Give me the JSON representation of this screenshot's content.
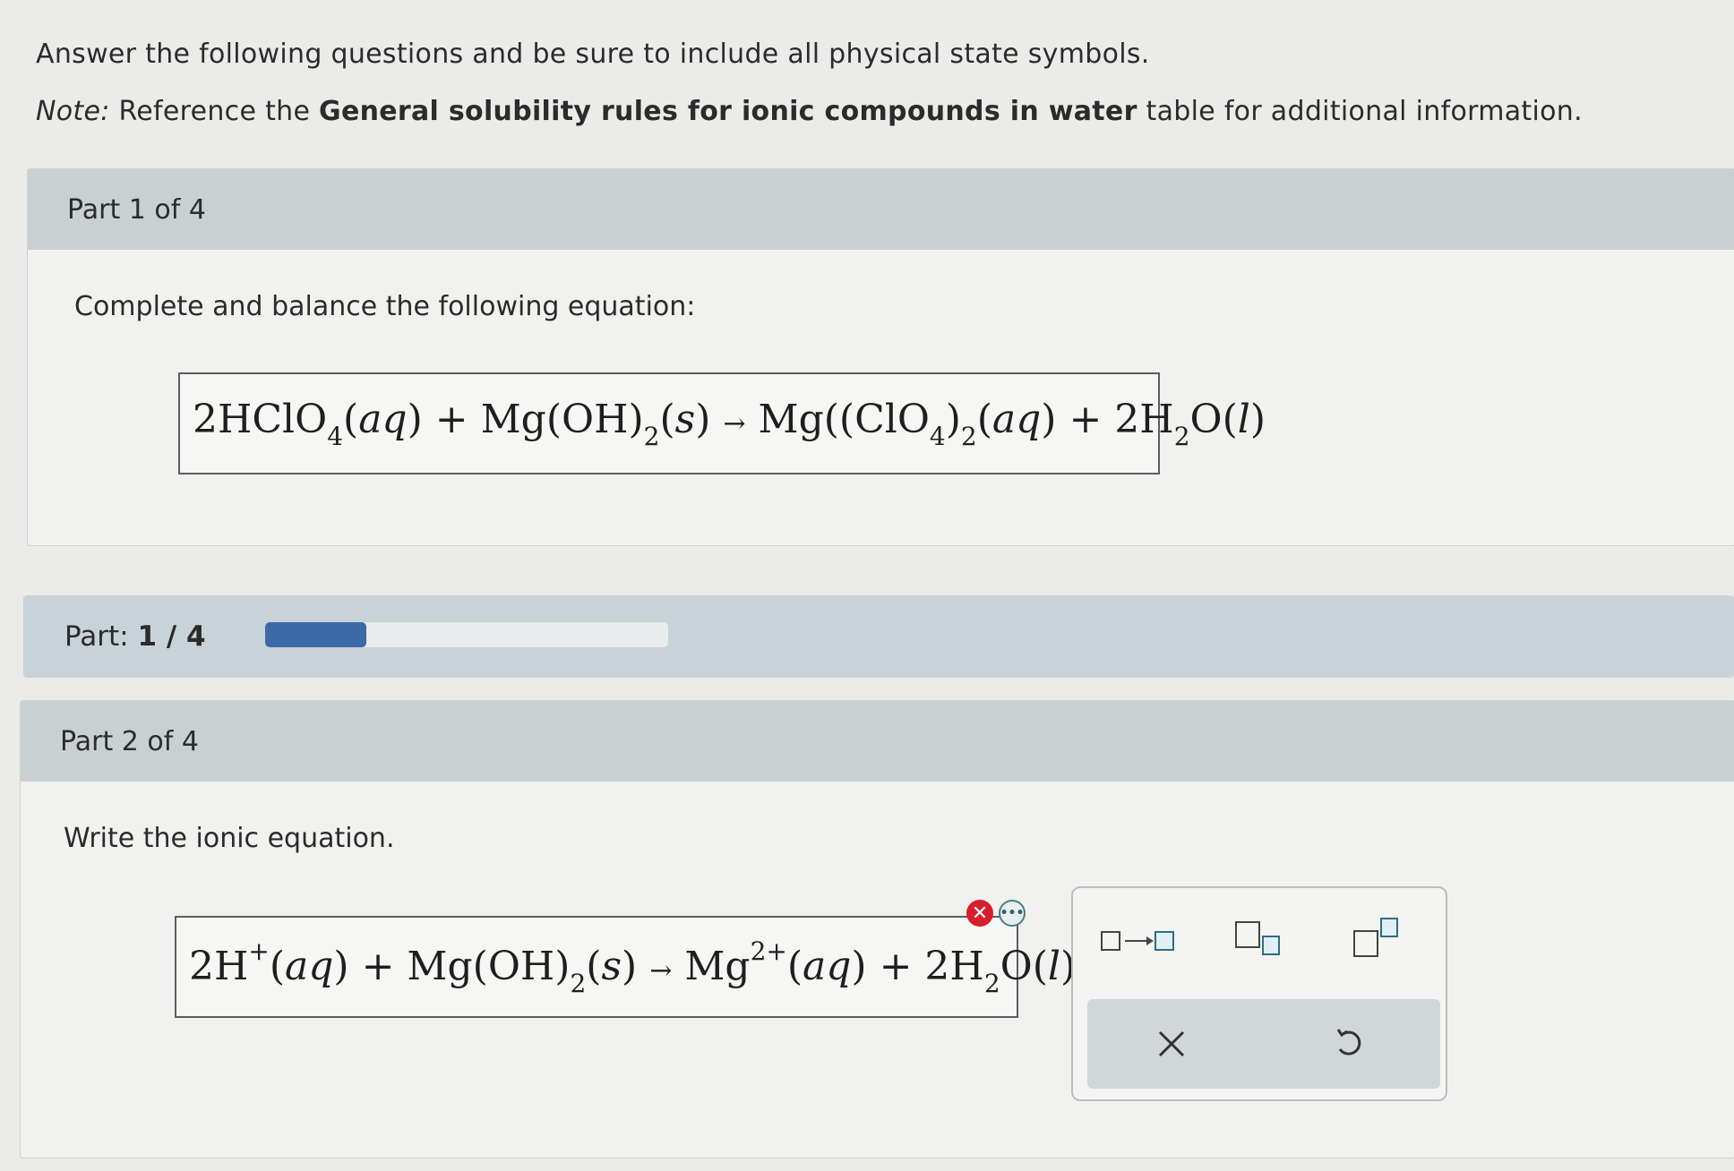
{
  "intro": {
    "line1": "Answer the following questions and be sure to include all physical state symbols.",
    "note_label": "Note:",
    "note_pre": " Reference the ",
    "note_bold": "General solubility rules for ionic compounds in water",
    "note_post": " table for additional information."
  },
  "part1": {
    "header": "Part 1 of 4",
    "prompt": "Complete and balance the following equation:",
    "equation": {
      "coef1": "2HClO",
      "sub1": "4",
      "state1": "aq",
      "plus1": " + Mg",
      "oh": "OH",
      "sub2": "2",
      "state2": "s",
      "arrow": "→",
      "prod1": "Mg",
      "clo": "ClO",
      "sub3": "4",
      "sub4": "2",
      "state3": "aq",
      "plus2": " + 2H",
      "sub5": "2",
      "o": "O",
      "state4": "l"
    }
  },
  "progress": {
    "label": "Part:",
    "value": "1 / 4",
    "fraction": 0.25,
    "fill_color": "#3c6aa8"
  },
  "part2": {
    "header": "Part 2 of 4",
    "prompt": "Write the ionic equation.",
    "equation": {
      "h": "2H",
      "sup1": "+",
      "state1": "aq",
      "plus1": " + Mg",
      "oh": "OH",
      "sub1": "2",
      "state2": "s",
      "arrow": "→",
      "mg": "Mg",
      "sup2": "2+",
      "state3": "aq",
      "plus2": " + 2H",
      "sub2": "2",
      "o": "O",
      "state4": "l"
    },
    "error_icon": "error-x-icon",
    "more_icon": "more-dots-icon"
  },
  "palette": {
    "tools": [
      "reaction-arrow-icon",
      "subscript-icon",
      "superscript-icon"
    ],
    "actions": [
      "clear-icon",
      "undo-icon"
    ]
  }
}
